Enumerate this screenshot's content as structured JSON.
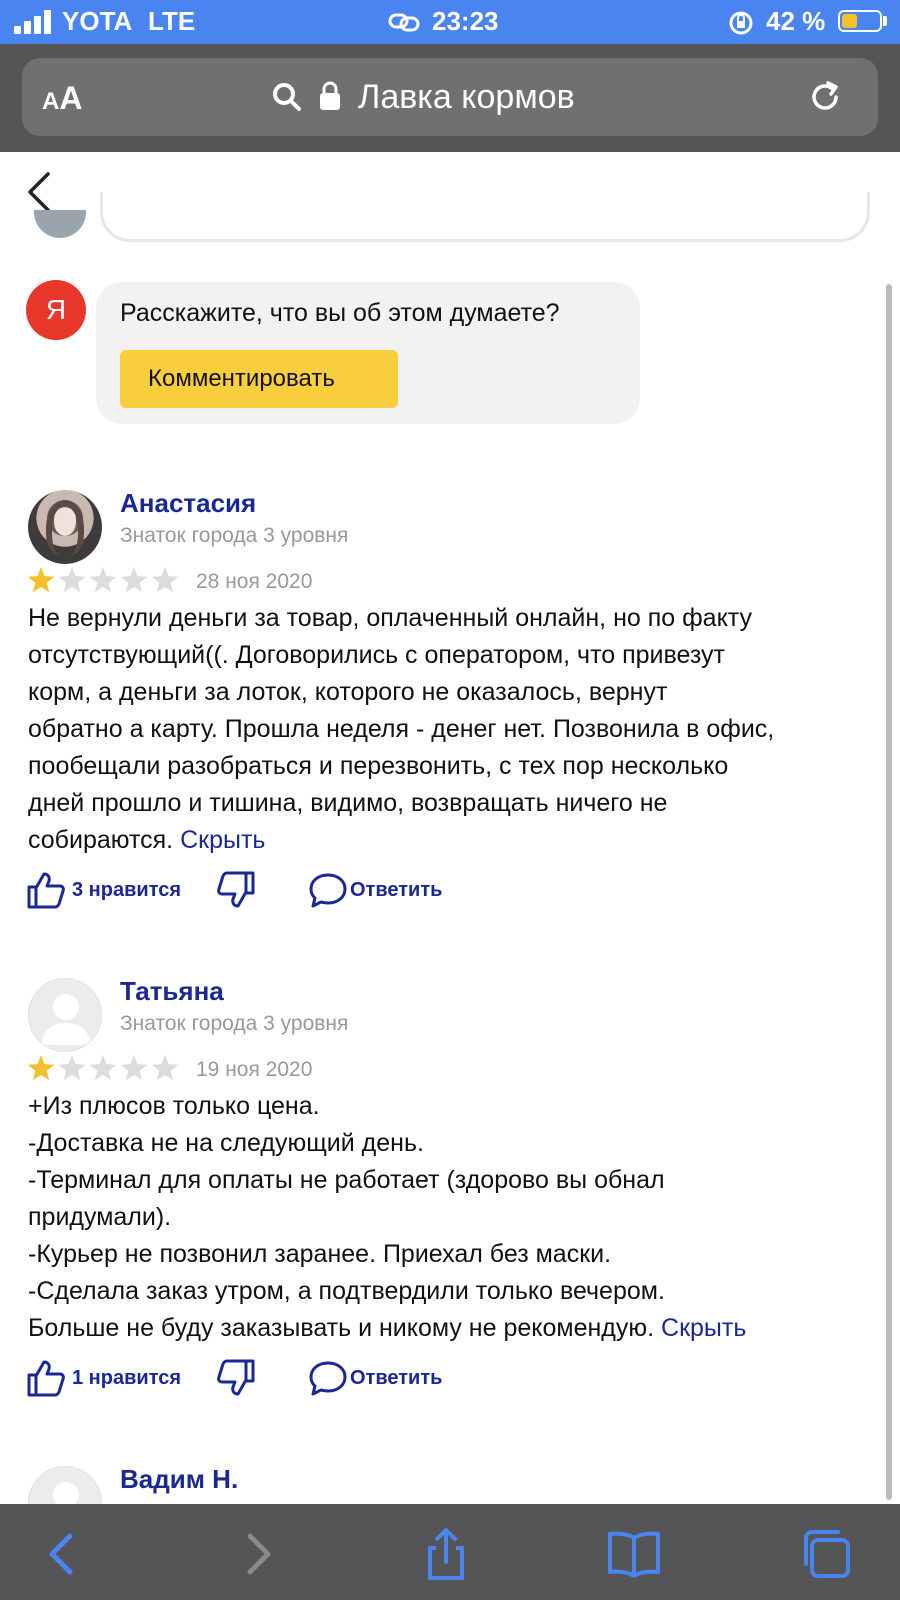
{
  "status_bar": {
    "carrier": "YOTA",
    "network": "LTE",
    "time": "23:23",
    "battery_percent": "42 %"
  },
  "browser": {
    "text_size_button": "AA",
    "site_title": "Лавка кормов"
  },
  "comment_prompt": {
    "logo_letter": "Я",
    "question": "Расскажите, что вы об этом думаете?",
    "button_label": "Комментировать"
  },
  "reviews": [
    {
      "author": "Анастасия",
      "level": "Знаток города 3 уровня",
      "rating": 1,
      "max_rating": 5,
      "date": "28 ноя 2020",
      "lines": [
        "Не вернули деньги за товар, оплаченный онлайн, но по факту",
        "отсутствующий((. Договорились с оператором, что привезут",
        "корм, а деньги за лоток, которого не оказалось, вернут",
        "обратно а карту. Прошла неделя - денег нет. Позвонила в офис,",
        "пообещали разобраться и перезвонить, с тех пор несколько",
        "дней прошло и тишина, видимо, возвращать ничего не",
        "собираются."
      ],
      "hide_label": "Скрыть",
      "likes_label": "3 нравится",
      "reply_label": "Ответить"
    },
    {
      "author": "Татьяна",
      "level": "Знаток города 3 уровня",
      "rating": 1,
      "max_rating": 5,
      "date": "19 ноя 2020",
      "lines": [
        "+Из плюсов только цена.",
        "-Доставка не на следующий день.",
        "-Терминал для оплаты не работает (здорово вы обнал",
        "придумали).",
        "-Курьер не позвонил заранее. Приехал без маски.",
        "-Сделала заказ утром, а подтвердили только вечером.",
        "Больше не буду заказывать и никому не рекомендую."
      ],
      "hide_label": "Скрыть",
      "likes_label": "1 нравится",
      "reply_label": "Ответить"
    },
    {
      "author": "Вадим Н."
    }
  ],
  "colors": {
    "status_bar": "#4a84f0",
    "chrome": "#555557",
    "link": "#1a2896",
    "yandex_red": "#e8362a",
    "comment_button": "#f8ce3c",
    "star_on": "#f5c02a",
    "star_off": "#dcdcdc",
    "toolbar_icon_active": "#4a84f0",
    "toolbar_icon_disabled": "#8a8a8c"
  }
}
